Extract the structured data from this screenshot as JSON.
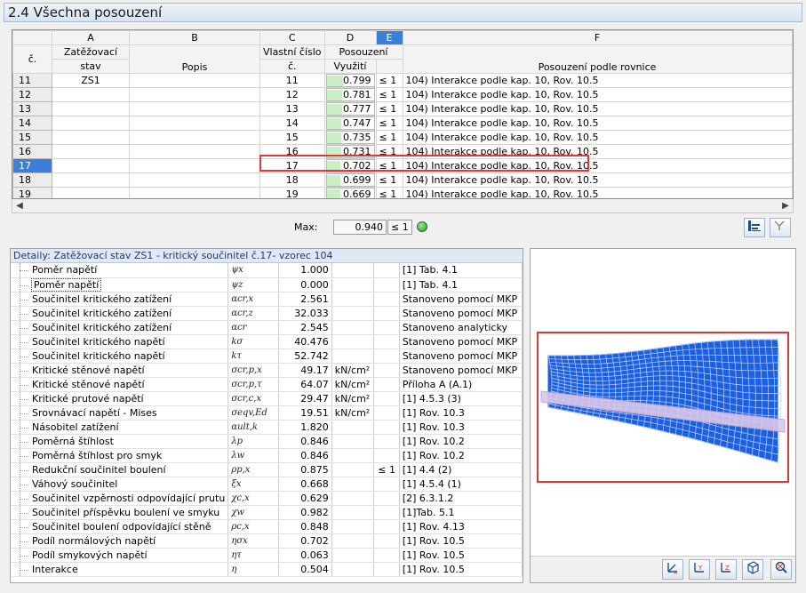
{
  "window": {
    "title": "2.4 Všechna posouzení"
  },
  "table": {
    "col_letters": [
      "A",
      "B",
      "C",
      "D",
      "E",
      "F"
    ],
    "headers": {
      "rownum": "č.",
      "a_line1": "Zatěžovací",
      "a_line2": "stav",
      "b": "Popis",
      "c_line1": "Vlastní číslo",
      "c_line2": "č.",
      "d_group": "Posouzení",
      "d": "Využití",
      "f": "Posouzení podle rovnice"
    },
    "rows": [
      {
        "n": "11",
        "load_case": "ZS1",
        "desc": "",
        "eig": "11",
        "util": "0.799",
        "util_frac": 0.799,
        "le": "≤ 1",
        "eq": "104) Interakce podle kap. 10, Rov. 10.5",
        "selected": false
      },
      {
        "n": "12",
        "load_case": "",
        "desc": "",
        "eig": "12",
        "util": "0.781",
        "util_frac": 0.781,
        "le": "≤ 1",
        "eq": "104) Interakce podle kap. 10, Rov. 10.5",
        "selected": false
      },
      {
        "n": "13",
        "load_case": "",
        "desc": "",
        "eig": "13",
        "util": "0.777",
        "util_frac": 0.777,
        "le": "≤ 1",
        "eq": "104) Interakce podle kap. 10, Rov. 10.5",
        "selected": false
      },
      {
        "n": "14",
        "load_case": "",
        "desc": "",
        "eig": "14",
        "util": "0.747",
        "util_frac": 0.747,
        "le": "≤ 1",
        "eq": "104) Interakce podle kap. 10, Rov. 10.5",
        "selected": false
      },
      {
        "n": "15",
        "load_case": "",
        "desc": "",
        "eig": "15",
        "util": "0.735",
        "util_frac": 0.735,
        "le": "≤ 1",
        "eq": "104) Interakce podle kap. 10, Rov. 10.5",
        "selected": false
      },
      {
        "n": "16",
        "load_case": "",
        "desc": "",
        "eig": "16",
        "util": "0.731",
        "util_frac": 0.731,
        "le": "≤ 1",
        "eq": "104) Interakce podle kap. 10, Rov. 10.5",
        "selected": false
      },
      {
        "n": "17",
        "load_case": "",
        "desc": "",
        "eig": "17",
        "util": "0.702",
        "util_frac": 0.702,
        "le": "≤ 1",
        "eq": "104) Interakce podle kap. 10, Rov. 10.5",
        "selected": true
      },
      {
        "n": "18",
        "load_case": "",
        "desc": "",
        "eig": "18",
        "util": "0.699",
        "util_frac": 0.699,
        "le": "≤ 1",
        "eq": "104) Interakce podle kap. 10, Rov. 10.5",
        "selected": false
      },
      {
        "n": "19",
        "load_case": "",
        "desc": "",
        "eig": "19",
        "util": "0.669",
        "util_frac": 0.669,
        "le": "≤ 1",
        "eq": "104) Interakce podle kap. 10, Rov. 10.5",
        "selected": false
      }
    ]
  },
  "max": {
    "label": "Max:",
    "value": "0.940",
    "le": "≤ 1"
  },
  "details": {
    "heading": "Detaily:  Zatěžovací stav ZS1 - kritický součinitel č.17- vzorec 104",
    "rows": [
      {
        "name": "Poměr napětí",
        "sym": "ψx",
        "val": "1.000",
        "unit": "",
        "le": "",
        "ref": "[1] Tab. 4.1"
      },
      {
        "name": "Poměr napětí",
        "sym": "ψz",
        "val": "0.000",
        "unit": "",
        "le": "",
        "ref": "[1] Tab. 4.1"
      },
      {
        "name": "Součinitel kritického zatížení",
        "sym": "αcr,x",
        "val": "2.561",
        "unit": "",
        "le": "",
        "ref": "Stanoveno pomocí MKP"
      },
      {
        "name": "Součinitel kritického zatížení",
        "sym": "αcr,z",
        "val": "32.033",
        "unit": "",
        "le": "",
        "ref": "Stanoveno pomocí MKP"
      },
      {
        "name": "Součinitel kritického zatížení",
        "sym": "αcr",
        "val": "2.545",
        "unit": "",
        "le": "",
        "ref": "Stanoveno analyticky"
      },
      {
        "name": "Součinitel kritického napětí",
        "sym": "kσ",
        "val": "40.476",
        "unit": "",
        "le": "",
        "ref": "Stanoveno pomocí MKP"
      },
      {
        "name": "Součinitel kritického napětí",
        "sym": "kτ",
        "val": "52.742",
        "unit": "",
        "le": "",
        "ref": "Stanoveno pomocí MKP"
      },
      {
        "name": "Kritické stěnové napětí",
        "sym": "σcr,p,x",
        "val": "49.17",
        "unit": "kN/cm²",
        "le": "",
        "ref": "Stanoveno pomocí MKP"
      },
      {
        "name": "Kritické stěnové napětí",
        "sym": "σcr,p,τ",
        "val": "64.07",
        "unit": "kN/cm²",
        "le": "",
        "ref": "Příloha A (A.1)"
      },
      {
        "name": "Kritické prutové napětí",
        "sym": "σcr,c,x",
        "val": "29.47",
        "unit": "kN/cm²",
        "le": "",
        "ref": "[1] 4.5.3 (3)"
      },
      {
        "name": "Srovnávací napětí - Mises",
        "sym": "σeqv,Ed",
        "val": "19.51",
        "unit": "kN/cm²",
        "le": "",
        "ref": "[1] Rov. 10.3"
      },
      {
        "name": "Násobitel zatížení",
        "sym": "αult,k",
        "val": "1.820",
        "unit": "",
        "le": "",
        "ref": "[1] Rov. 10.3"
      },
      {
        "name": "Poměrná štíhlost",
        "sym": "λp",
        "val": "0.846",
        "unit": "",
        "le": "",
        "ref": "[1] Rov. 10.2"
      },
      {
        "name": "Poměrná štíhlost pro smyk",
        "sym": "λw",
        "val": "0.846",
        "unit": "",
        "le": "",
        "ref": "[1] Rov. 10.2"
      },
      {
        "name": "Redukční součinitel boulení",
        "sym": "ρp,x",
        "val": "0.875",
        "unit": "",
        "le": "≤ 1",
        "ref": "[1] 4.4 (2)"
      },
      {
        "name": "Váhový součinitel",
        "sym": "ξx",
        "val": "0.668",
        "unit": "",
        "le": "",
        "ref": "[1] 4.5.4 (1)"
      },
      {
        "name": "Součinitel vzpěrnosti odpovídající prutu",
        "sym": "χc,x",
        "val": "0.629",
        "unit": "",
        "le": "",
        "ref": "[2] 6.3.1.2"
      },
      {
        "name": "Součinitel příspěvku boulení ve smyku",
        "sym": "χw",
        "val": "0.982",
        "unit": "",
        "le": "",
        "ref": "[1]Tab. 5.1"
      },
      {
        "name": "Součinitel boulení odpovídající stěně",
        "sym": "ρc,x",
        "val": "0.848",
        "unit": "",
        "le": "",
        "ref": "[1] Rov. 4.13"
      },
      {
        "name": "Podíl normálových napětí",
        "sym": "ησx",
        "val": "0.702",
        "unit": "",
        "le": "",
        "ref": "[1] Rov. 10.5"
      },
      {
        "name": "Podíl smykových napětí",
        "sym": "ητ",
        "val": "0.063",
        "unit": "",
        "le": "",
        "ref": "[1] Rov. 10.5"
      },
      {
        "name": "Interakce",
        "sym": "η",
        "val": "0.504",
        "unit": "",
        "le": "",
        "ref": "[1] Rov. 10.5"
      }
    ]
  },
  "icons": {
    "table_btn_1": "filter-table-icon",
    "table_btn_2": "filter-ratio-icon",
    "preview_btns": [
      "view-x-icon",
      "view-y-icon",
      "view-z-icon",
      "view-iso-icon",
      "reset-view-icon"
    ]
  },
  "colors": {
    "selected_row": "#3b7fd9",
    "highlight": "#d83b3b",
    "util_bar": "#c9f0c5",
    "mesh": "#1c5fe0",
    "beam": "#d9c8e8"
  }
}
